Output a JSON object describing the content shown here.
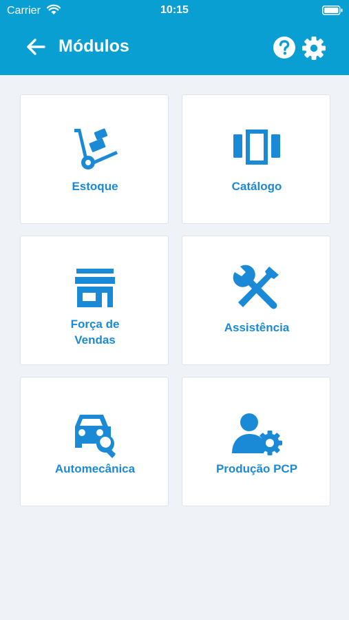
{
  "status_bar": {
    "carrier": "Carrier",
    "time": "10:15"
  },
  "toolbar": {
    "title": "Módulos"
  },
  "colors": {
    "app_bar": "#0a9fd3",
    "accent": "#1b8ad6",
    "background": "#eff3f8"
  },
  "modules": [
    {
      "label": "Estoque",
      "icon": "hand-truck-icon"
    },
    {
      "label": "Catálogo",
      "icon": "carousel-icon"
    },
    {
      "label": "Força de\nVendas",
      "icon": "storefront-icon"
    },
    {
      "label": "Assistência",
      "icon": "tools-icon"
    },
    {
      "label": "Automecânica",
      "icon": "car-wrench-icon"
    },
    {
      "label": "Produção PCP",
      "icon": "user-gear-icon"
    }
  ]
}
